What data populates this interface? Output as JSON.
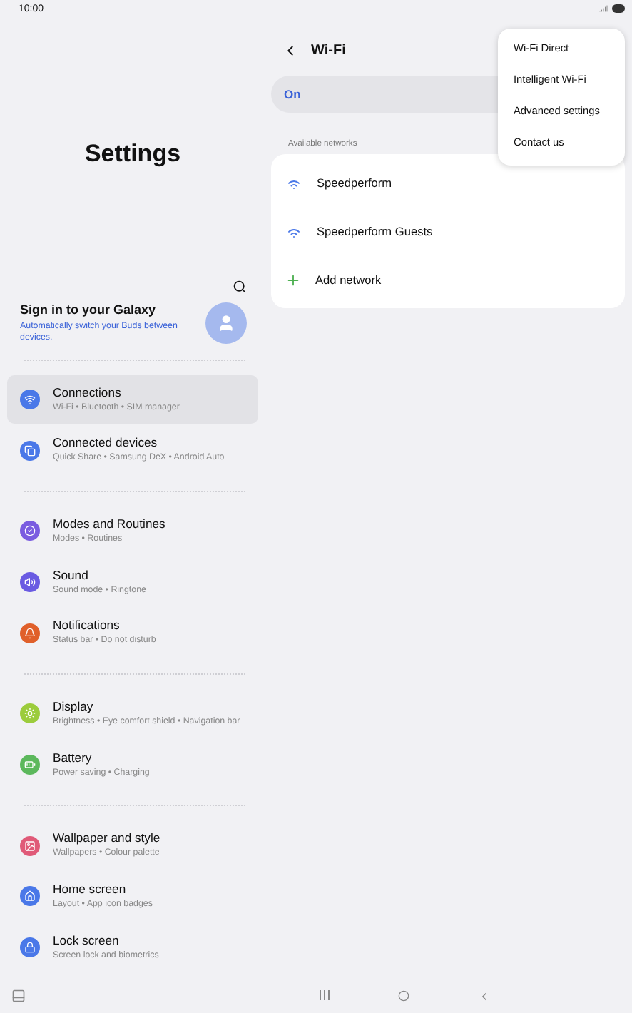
{
  "status_bar": {
    "time": "10:00"
  },
  "settings": {
    "title": "Settings",
    "account": {
      "title": "Sign in to your Galaxy",
      "subtitle": "Automatically switch your Buds between devices."
    },
    "groups": [
      [
        {
          "kind": "wifi",
          "color": "#4a78e8",
          "title": "Connections",
          "subtitle": "Wi-Fi  •  Bluetooth  •  SIM manager",
          "selected": true
        },
        {
          "kind": "devices",
          "color": "#4a78e8",
          "title": "Connected devices",
          "subtitle": "Quick Share  •  Samsung DeX  •  Android Auto",
          "selected": false
        }
      ],
      [
        {
          "kind": "modes",
          "color": "#7a5ce0",
          "title": "Modes and Routines",
          "subtitle": "Modes  •  Routines",
          "selected": false
        },
        {
          "kind": "sound",
          "color": "#6a5be2",
          "title": "Sound",
          "subtitle": "Sound mode  •  Ringtone",
          "selected": false
        },
        {
          "kind": "bell",
          "color": "#e0602a",
          "title": "Notifications",
          "subtitle": "Status bar  •  Do not disturb",
          "selected": false
        }
      ],
      [
        {
          "kind": "display",
          "color": "#9ccc3c",
          "title": "Display",
          "subtitle": "Brightness  •  Eye comfort shield  •  Navigation bar",
          "selected": false
        },
        {
          "kind": "battery",
          "color": "#5cb85c",
          "title": "Battery",
          "subtitle": "Power saving  •  Charging",
          "selected": false
        }
      ],
      [
        {
          "kind": "wallpaper",
          "color": "#e05a78",
          "title": "Wallpaper and style",
          "subtitle": "Wallpapers  •  Colour palette",
          "selected": false
        },
        {
          "kind": "home",
          "color": "#4a78e8",
          "title": "Home screen",
          "subtitle": "Layout  •  App icon badges",
          "selected": false
        },
        {
          "kind": "lock",
          "color": "#4a78e8",
          "title": "Lock screen",
          "subtitle": "Screen lock and biometrics",
          "selected": false
        }
      ]
    ]
  },
  "wifi": {
    "title": "Wi-Fi",
    "toggle_label": "On",
    "section": "Available networks",
    "networks": [
      {
        "kind": "network",
        "name": "Speedperform"
      },
      {
        "kind": "network",
        "name": "Speedperform Guests"
      },
      {
        "kind": "add",
        "name": "Add network"
      }
    ]
  },
  "menu": [
    "Wi-Fi Direct",
    "Intelligent Wi-Fi",
    "Advanced settings",
    "Contact us"
  ]
}
